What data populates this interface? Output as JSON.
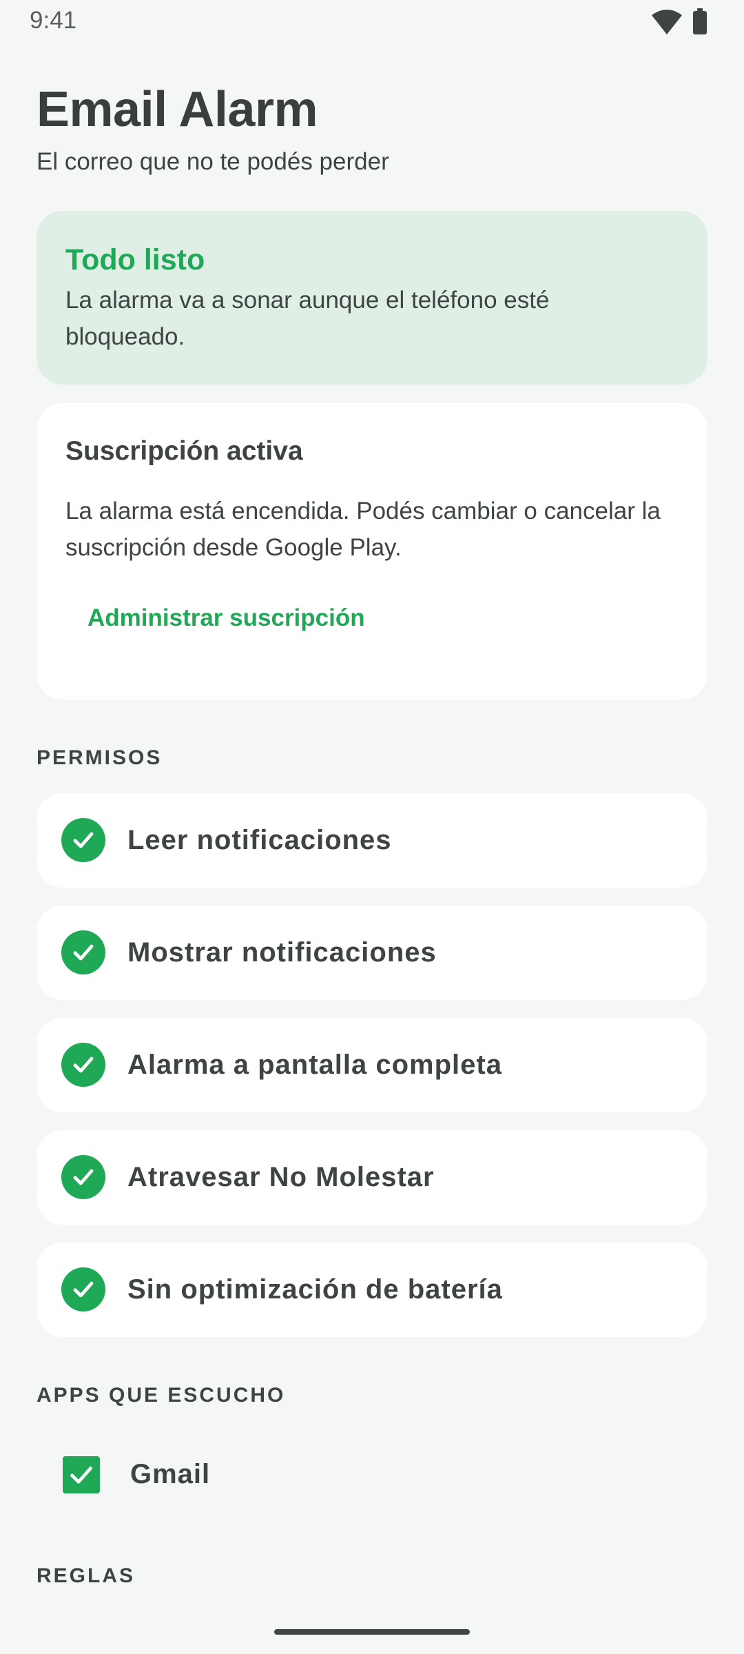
{
  "status_bar": {
    "time": "9:41",
    "icons": [
      "wifi-icon",
      "battery-icon"
    ]
  },
  "header": {
    "title": "Email Alarm",
    "subtitle": "El correo que no te podés perder"
  },
  "ready_card": {
    "title": "Todo listo",
    "text": "La alarma va a sonar aunque el teléfono esté bloqueado."
  },
  "subscription_card": {
    "title": "Suscripción activa",
    "text": "La alarma está encendida. Podés cambiar o cancelar la suscripción desde Google Play.",
    "button_label": "Administrar suscripción"
  },
  "permissions": {
    "section_label": "PERMISOS",
    "items": [
      {
        "label": "Leer notificaciones",
        "granted": true
      },
      {
        "label": "Mostrar notificaciones",
        "granted": true
      },
      {
        "label": "Alarma a pantalla completa",
        "granted": true
      },
      {
        "label": "Atravesar No Molestar",
        "granted": true
      },
      {
        "label": "Sin optimización de batería",
        "granted": true
      }
    ]
  },
  "apps": {
    "section_label": "APPS QUE ESCUCHO",
    "items": [
      {
        "label": "Gmail",
        "checked": true
      }
    ]
  },
  "rules": {
    "section_label": "REGLAS"
  },
  "colors": {
    "accent": "#1fa855",
    "background": "#f5f7f6",
    "ready_card_bg": "#e0efe6",
    "card_bg": "#ffffff",
    "text": "#3d4441"
  }
}
